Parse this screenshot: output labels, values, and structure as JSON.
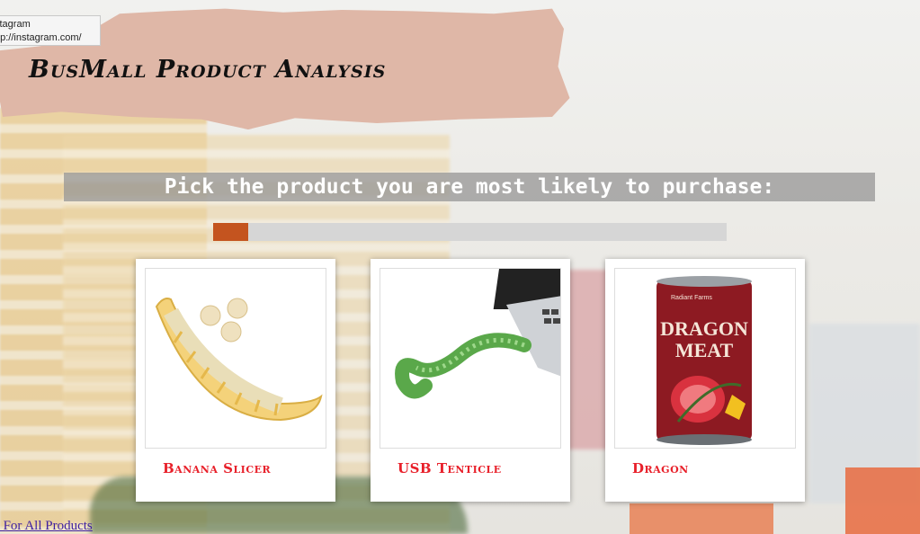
{
  "status_tooltip": {
    "line1": "stagram",
    "line2": "ttp://instagram.com/"
  },
  "header": {
    "title": "BusMall Product Analysis"
  },
  "prompt": {
    "text": "Pick the product you are most likely to purchase:"
  },
  "progress": {
    "fraction": 0.068,
    "fill_color": "#c4541f"
  },
  "products": [
    {
      "label": "Banana Slicer",
      "image_icon": "banana-slicer-image"
    },
    {
      "label": "USB Tenticle",
      "image_icon": "usb-tentacle-image"
    },
    {
      "label": "Dragon",
      "image_icon": "dragon-meat-can-image",
      "can_text": {
        "brand": "Radiant Farms",
        "line1": "DRAGON",
        "line2": "MEAT"
      }
    }
  ],
  "footer": {
    "link_text": "s For All Products"
  },
  "colors": {
    "accent": "#e8202a",
    "paper": "#dfb7a7"
  }
}
